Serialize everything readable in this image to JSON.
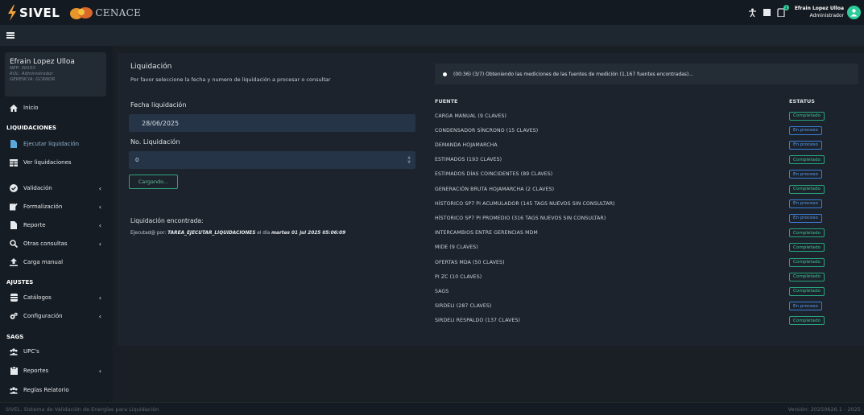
{
  "header": {
    "logo_text": "SIVEL",
    "cenace_text": "CENACE",
    "user_name": "Efrain Lopez Ulloa",
    "user_role": "Administrador",
    "notification_count": "1"
  },
  "profile": {
    "name": "Efrain Lopez Ulloa",
    "nep": "NEP: 30103",
    "rol": "ROL: Administrador",
    "gerencia": "GERENCIA: GCRNOR"
  },
  "sidebar": {
    "inicio": "Inicio",
    "sec_liquidaciones": "LIQUIDACIONES",
    "ejecutar": "Ejecutar liquidación",
    "ver": "Ver liquidaciones",
    "validacion": "Validación",
    "formalizacion": "Formalización",
    "reporte": "Reporte",
    "otras": "Otras consultas",
    "carga": "Carga manual",
    "sec_ajustes": "AJUSTES",
    "catalogos": "Catálogos",
    "configuracion": "Configuración",
    "sec_sags": "SAGS",
    "upcs": "UPC's",
    "reportes": "Reportes",
    "reglas": "Reglas Relatorio"
  },
  "form": {
    "title": "Liquidación",
    "subtitle": "Por favor seleccione la fecha y numero de liquidación a procesar o consultar",
    "fecha_label": "Fecha liquidación",
    "fecha_value": "28/06/2025",
    "numero_label": "No. Liquidación",
    "numero_value": "0",
    "button_label": "Cargando...",
    "found_title": "Liquidación encontrada:",
    "found_prefix": "Ejecutad@ por: ",
    "found_task": "TAREA_EJECUTAR_LIQUIDACIONES",
    "found_mid": " el día ",
    "found_date": "martes 01 jul 2025 05:06:09"
  },
  "progress": {
    "message": "(00:36) (3/7) Obteniendo las mediciones de las fuentes de medición (1,167 fuentes encontradas)..."
  },
  "table": {
    "col_fuente": "FUENTE",
    "col_estatus": "ESTATUS",
    "rows": [
      {
        "fuente": "CARGA MANUAL (9 CLAVES)",
        "estatus": "Completado"
      },
      {
        "fuente": "CONDENSADOR SÍNCRONO (15 CLAVES)",
        "estatus": "En proceso"
      },
      {
        "fuente": "DEMANDA HOJAMARCHA",
        "estatus": "En proceso"
      },
      {
        "fuente": "ESTIMADOS (193 CLAVES)",
        "estatus": "Completado"
      },
      {
        "fuente": "ESTIMADOS DÍAS COINCIDENTES (89 CLAVES)",
        "estatus": "En proceso"
      },
      {
        "fuente": "GENERACIÓN BRUTA HOJAMARCHA (2 CLAVES)",
        "estatus": "Completado"
      },
      {
        "fuente": "HÍSTORICO SP7 PI ACUMULADOR (145 TAGS NUEVOS SIN CONSULTAR)",
        "estatus": "En proceso"
      },
      {
        "fuente": "HÍSTORICO SP7 PI PROMEDIO (316 TAGS NUEVOS SIN CONSULTAR)",
        "estatus": "En proceso"
      },
      {
        "fuente": "INTERCAMBIOS ENTRE GERENCIAS MDM",
        "estatus": "Completado"
      },
      {
        "fuente": "MIDE (9 CLAVES)",
        "estatus": "Completado"
      },
      {
        "fuente": "OFERTAS MDA (50 CLAVES)",
        "estatus": "Completado"
      },
      {
        "fuente": "PI ZC (10 CLAVES)",
        "estatus": "Completado"
      },
      {
        "fuente": "SAGS",
        "estatus": "Completado"
      },
      {
        "fuente": "SIRDELI (287 CLAVES)",
        "estatus": "En proceso"
      },
      {
        "fuente": "SIRDELI RESPALDO (137 CLAVES)",
        "estatus": "Completado"
      }
    ]
  },
  "footer": {
    "left": "SIVEL. Sistema de Validación de Energías para Liquidación",
    "right": "Versión: 20250626.1 - 2025"
  },
  "colors": {
    "completado": "#3fc596",
    "en_proceso": "#5a9df0",
    "accent": "#5aa7de"
  }
}
